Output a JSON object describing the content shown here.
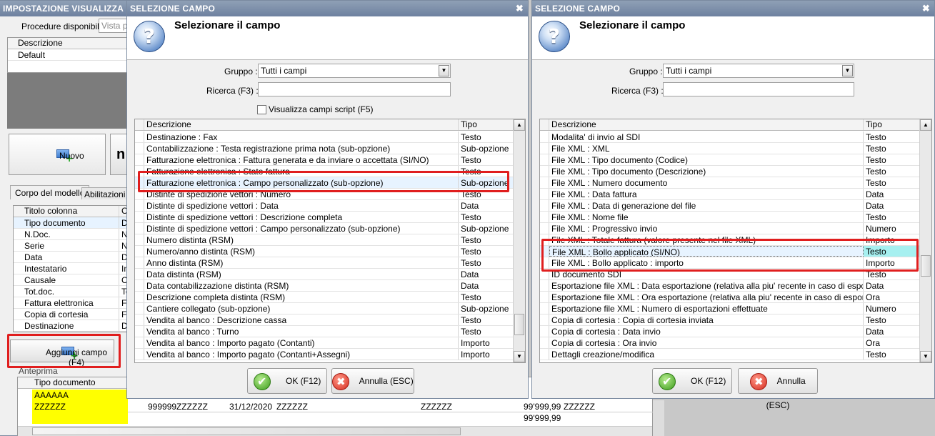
{
  "bg_window": {
    "title": "IMPOSTAZIONE VISUALIZZA",
    "procedure_label": "Procedure disponibili :",
    "procedure_value": "Vista p",
    "desc_header": "Descrizione",
    "desc_value": "Default",
    "nuovo_label": "Nuovo",
    "tabs": [
      "Corpo del modello",
      "Abilitazioni"
    ],
    "col_header": "Titolo colonna",
    "col_header2": "C",
    "columns": [
      {
        "name": "Tipo documento",
        "c": "De"
      },
      {
        "name": "N.Doc.",
        "c": "Nu"
      },
      {
        "name": "Serie",
        "c": "Nu"
      },
      {
        "name": "Data",
        "c": "Da"
      },
      {
        "name": "Intestatario",
        "c": "In"
      },
      {
        "name": "Causale",
        "c": "Ca"
      },
      {
        "name": "Tot.doc.",
        "c": "To"
      },
      {
        "name": "Fattura elettronica",
        "c": "Fa"
      },
      {
        "name": "Copia di cortesia",
        "c": "Fa"
      },
      {
        "name": "Destinazione",
        "c": "De"
      }
    ],
    "add_field_label": "Aggiungi campo (F4)",
    "preview_label": "Anteprima",
    "preview_header": "Tipo documento",
    "preview_rows": [
      "AAAAAA",
      "ZZZZZZ",
      ""
    ],
    "preview_row2": [
      "999999",
      "ZZZZZZ",
      "31/12/2020",
      "ZZZZZZ",
      "ZZZZZZ",
      "99'999,99",
      "ZZZZZZ"
    ],
    "preview_row3_total": "99'999,99"
  },
  "dialog_left": {
    "title": "SELEZIONE CAMPO",
    "heading": "Selezionare il campo",
    "gruppo_label": "Gruppo :",
    "gruppo_value": "Tutti i campi",
    "ricerca_label": "Ricerca (F3) :",
    "ricerca_value": "",
    "script_label": "Visualizza campi script (F5)",
    "col_desc": "Descrizione",
    "col_tipo": "Tipo",
    "rows": [
      {
        "d": "Destinazione : Fax",
        "t": "Testo"
      },
      {
        "d": "Contabilizzazione : Testa registrazione prima nota (sub-opzione)",
        "t": "Sub-opzione"
      },
      {
        "d": "Fatturazione elettronica : Fattura generata e da inviare o accettata (SI/NO)",
        "t": "Testo"
      },
      {
        "d": "Fatturazione elettronica : Stato fattura",
        "t": "Testo"
      },
      {
        "d": "Fatturazione elettronica : Campo personalizzato (sub-opzione)",
        "t": "Sub-opzione"
      },
      {
        "d": "Distinte di spedizione vettori : Numero",
        "t": "Testo"
      },
      {
        "d": "Distinte di spedizione vettori : Data",
        "t": "Data"
      },
      {
        "d": "Distinte di spedizione vettori : Descrizione completa",
        "t": "Testo"
      },
      {
        "d": "Distinte di spedizione vettori : Campo personalizzato (sub-opzione)",
        "t": "Sub-opzione"
      },
      {
        "d": "Numero distinta (RSM)",
        "t": "Testo"
      },
      {
        "d": "Numero/anno distinta (RSM)",
        "t": "Testo"
      },
      {
        "d": "Anno distinta (RSM)",
        "t": "Testo"
      },
      {
        "d": "Data distinta (RSM)",
        "t": "Data"
      },
      {
        "d": "Data contabilizzazione distinta (RSM)",
        "t": "Data"
      },
      {
        "d": "Descrizione completa distinta (RSM)",
        "t": "Testo"
      },
      {
        "d": "Cantiere collegato (sub-opzione)",
        "t": "Sub-opzione"
      },
      {
        "d": "Vendita al banco : Descrizione cassa",
        "t": "Testo"
      },
      {
        "d": "Vendita al banco : Turno",
        "t": "Testo"
      },
      {
        "d": "Vendita al banco : Importo pagato (Contanti)",
        "t": "Importo"
      },
      {
        "d": "Vendita al banco : Importo pagato (Contanti+Assegni)",
        "t": "Importo"
      }
    ],
    "ok_label": "OK (F12)",
    "cancel_label": "Annulla (ESC)"
  },
  "dialog_right": {
    "title": "SELEZIONE CAMPO",
    "heading": "Selezionare il campo",
    "gruppo_label": "Gruppo :",
    "gruppo_value": "Tutti i campi",
    "ricerca_label": "Ricerca (F3) :",
    "ricerca_value": "",
    "col_desc": "Descrizione",
    "col_tipo": "Tipo",
    "rows": [
      {
        "d": "Modalita' di invio al SDI",
        "t": "Testo"
      },
      {
        "d": "File XML : XML",
        "t": "Testo"
      },
      {
        "d": "File XML : Tipo documento (Codice)",
        "t": "Testo"
      },
      {
        "d": "File XML : Tipo documento (Descrizione)",
        "t": "Testo"
      },
      {
        "d": "File XML : Numero documento",
        "t": "Testo"
      },
      {
        "d": "File XML : Data fattura",
        "t": "Data"
      },
      {
        "d": "File XML : Data di generazione del file",
        "t": "Data"
      },
      {
        "d": "File XML : Nome file",
        "t": "Testo"
      },
      {
        "d": "File XML : Progressivo invio",
        "t": "Numero"
      },
      {
        "d": "File XML : Totale fattura (valore presente nel file XML)",
        "t": "Importo"
      },
      {
        "d": "File XML : Bollo applicato (SI/NO)",
        "t": "Testo"
      },
      {
        "d": "File XML : Bollo applicato : importo",
        "t": "Importo"
      },
      {
        "d": "ID documento SDI",
        "t": "Testo"
      },
      {
        "d": "Esportazione file XML : Data esportazione (relativa alla piu' recente in caso di esportazio...",
        "t": "Data"
      },
      {
        "d": "Esportazione file XML : Ora esportazione (relativa alla piu' recente in caso di esportazione...",
        "t": "Ora"
      },
      {
        "d": "Esportazione file XML : Numero di esportazioni effettuate",
        "t": "Numero"
      },
      {
        "d": "Copia di cortesia : Copia di cortesia inviata",
        "t": "Testo"
      },
      {
        "d": "Copia di cortesia : Data invio",
        "t": "Data"
      },
      {
        "d": "Copia di cortesia : Ora invio",
        "t": "Ora"
      },
      {
        "d": "Dettagli creazione/modifica",
        "t": "Testo"
      }
    ],
    "ok_label": "OK (F12)",
    "cancel_label": "Annulla (ESC)"
  }
}
